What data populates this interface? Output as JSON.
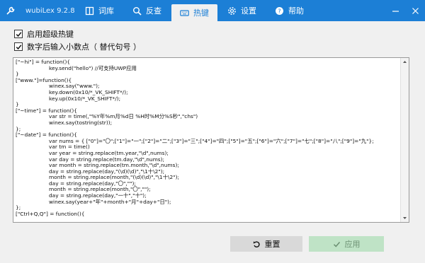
{
  "window": {
    "title": "wubiLex 9.2.8",
    "tabs": [
      {
        "label": "词库",
        "icon": "book-icon"
      },
      {
        "label": "反查",
        "icon": "search-icon"
      },
      {
        "label": "热键",
        "icon": "keyboard-icon"
      },
      {
        "label": "设置",
        "icon": "gear-icon"
      },
      {
        "label": "帮助",
        "icon": "help-icon"
      }
    ],
    "active_tab": "热键"
  },
  "options": {
    "enable_super_hotkey": {
      "label": "启用超级热键",
      "checked": true
    },
    "decimal_after_number": {
      "label": "数字后输入小数点（ 替代句号 ）",
      "checked": true
    }
  },
  "editor": {
    "lines": [
      "[\"~hi\"] = function(){",
      "                    key.send(\"hello\") //可支持UWP应用",
      "}",
      "[\"www.\"]=function(){",
      "                    winex.say(\"www.\");",
      "                    key.down(0x10/*_VK_SHIFT*/);",
      "                    key.up(0x10/*_VK_SHIFT*/);",
      "}",
      "[\"~time\"] = function(){",
      "                    var str = time(,\"%Y年%m月%d日 %H时%M分%S秒\",\"chs\")",
      "                    winex.say(tostring(str));",
      "};",
      "[\"~date\"] = function(){",
      "                    var nums = { [\"0\"]=\"〇\";[\"1\"]=\"一\";[\"2\"]=\"二\";[\"3\"]=\"三\";[\"4\"]=\"四\";[\"5\"]=\"五\";[\"6\"]=\"六\";[\"7\"]=\"七\";[\"8\"]=\"八\";[\"9\"]=\"九\"};",
      "                    var tm = time()",
      "                    var year = string.replace(tm.year,\"\\d\",nums);",
      "                    var day = string.replace(tm.day,\"\\d\",nums);",
      "                    var month = string.replace(tm.month,\"\\d\",nums);",
      "                    day = string.replace(day,\"(\\d)(\\d)\",\"\\1十\\2\");",
      "                    month = string.replace(month,\"(\\d)(\\d)\",\"\\1十\\2\");",
      "                    day = string.replace(day,\"〇\",\"\");",
      "                    month = string.replace(month,\"〇\",\"\");",
      "                    day = string.replace(day,\"一十\",\"十\");",
      "                    winex.say(year+\"年\"+month+\"月\"+day+\"日\");",
      "};",
      "[\"Ctrl+Q,Q\"] = function(){"
    ]
  },
  "buttons": {
    "reset": {
      "label": "重置",
      "icon": "undo-icon"
    },
    "apply": {
      "label": "应用",
      "icon": "check-icon"
    }
  },
  "colors": {
    "accent": "#1c7fd6",
    "apply_bg": "#bfe3c6",
    "reset_bg": "#d9d9d9"
  }
}
